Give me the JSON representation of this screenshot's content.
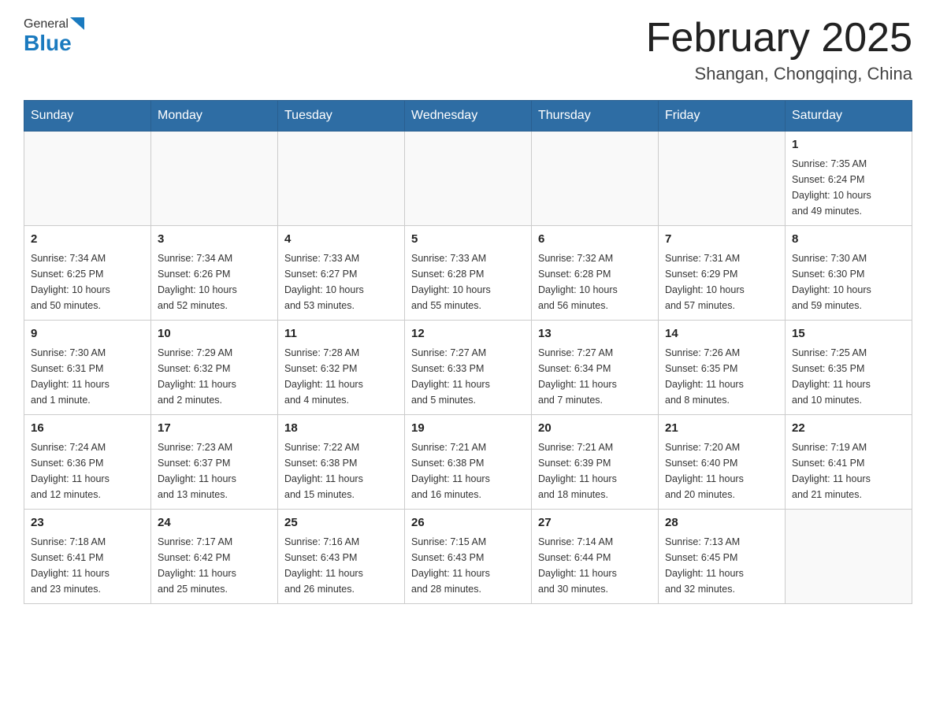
{
  "header": {
    "logo_general": "General",
    "logo_blue": "Blue",
    "month_title": "February 2025",
    "location": "Shangan, Chongqing, China"
  },
  "days_of_week": [
    "Sunday",
    "Monday",
    "Tuesday",
    "Wednesday",
    "Thursday",
    "Friday",
    "Saturday"
  ],
  "weeks": [
    {
      "cells": [
        {
          "day": "",
          "info": ""
        },
        {
          "day": "",
          "info": ""
        },
        {
          "day": "",
          "info": ""
        },
        {
          "day": "",
          "info": ""
        },
        {
          "day": "",
          "info": ""
        },
        {
          "day": "",
          "info": ""
        },
        {
          "day": "1",
          "info": "Sunrise: 7:35 AM\nSunset: 6:24 PM\nDaylight: 10 hours\nand 49 minutes."
        }
      ]
    },
    {
      "cells": [
        {
          "day": "2",
          "info": "Sunrise: 7:34 AM\nSunset: 6:25 PM\nDaylight: 10 hours\nand 50 minutes."
        },
        {
          "day": "3",
          "info": "Sunrise: 7:34 AM\nSunset: 6:26 PM\nDaylight: 10 hours\nand 52 minutes."
        },
        {
          "day": "4",
          "info": "Sunrise: 7:33 AM\nSunset: 6:27 PM\nDaylight: 10 hours\nand 53 minutes."
        },
        {
          "day": "5",
          "info": "Sunrise: 7:33 AM\nSunset: 6:28 PM\nDaylight: 10 hours\nand 55 minutes."
        },
        {
          "day": "6",
          "info": "Sunrise: 7:32 AM\nSunset: 6:28 PM\nDaylight: 10 hours\nand 56 minutes."
        },
        {
          "day": "7",
          "info": "Sunrise: 7:31 AM\nSunset: 6:29 PM\nDaylight: 10 hours\nand 57 minutes."
        },
        {
          "day": "8",
          "info": "Sunrise: 7:30 AM\nSunset: 6:30 PM\nDaylight: 10 hours\nand 59 minutes."
        }
      ]
    },
    {
      "cells": [
        {
          "day": "9",
          "info": "Sunrise: 7:30 AM\nSunset: 6:31 PM\nDaylight: 11 hours\nand 1 minute."
        },
        {
          "day": "10",
          "info": "Sunrise: 7:29 AM\nSunset: 6:32 PM\nDaylight: 11 hours\nand 2 minutes."
        },
        {
          "day": "11",
          "info": "Sunrise: 7:28 AM\nSunset: 6:32 PM\nDaylight: 11 hours\nand 4 minutes."
        },
        {
          "day": "12",
          "info": "Sunrise: 7:27 AM\nSunset: 6:33 PM\nDaylight: 11 hours\nand 5 minutes."
        },
        {
          "day": "13",
          "info": "Sunrise: 7:27 AM\nSunset: 6:34 PM\nDaylight: 11 hours\nand 7 minutes."
        },
        {
          "day": "14",
          "info": "Sunrise: 7:26 AM\nSunset: 6:35 PM\nDaylight: 11 hours\nand 8 minutes."
        },
        {
          "day": "15",
          "info": "Sunrise: 7:25 AM\nSunset: 6:35 PM\nDaylight: 11 hours\nand 10 minutes."
        }
      ]
    },
    {
      "cells": [
        {
          "day": "16",
          "info": "Sunrise: 7:24 AM\nSunset: 6:36 PM\nDaylight: 11 hours\nand 12 minutes."
        },
        {
          "day": "17",
          "info": "Sunrise: 7:23 AM\nSunset: 6:37 PM\nDaylight: 11 hours\nand 13 minutes."
        },
        {
          "day": "18",
          "info": "Sunrise: 7:22 AM\nSunset: 6:38 PM\nDaylight: 11 hours\nand 15 minutes."
        },
        {
          "day": "19",
          "info": "Sunrise: 7:21 AM\nSunset: 6:38 PM\nDaylight: 11 hours\nand 16 minutes."
        },
        {
          "day": "20",
          "info": "Sunrise: 7:21 AM\nSunset: 6:39 PM\nDaylight: 11 hours\nand 18 minutes."
        },
        {
          "day": "21",
          "info": "Sunrise: 7:20 AM\nSunset: 6:40 PM\nDaylight: 11 hours\nand 20 minutes."
        },
        {
          "day": "22",
          "info": "Sunrise: 7:19 AM\nSunset: 6:41 PM\nDaylight: 11 hours\nand 21 minutes."
        }
      ]
    },
    {
      "cells": [
        {
          "day": "23",
          "info": "Sunrise: 7:18 AM\nSunset: 6:41 PM\nDaylight: 11 hours\nand 23 minutes."
        },
        {
          "day": "24",
          "info": "Sunrise: 7:17 AM\nSunset: 6:42 PM\nDaylight: 11 hours\nand 25 minutes."
        },
        {
          "day": "25",
          "info": "Sunrise: 7:16 AM\nSunset: 6:43 PM\nDaylight: 11 hours\nand 26 minutes."
        },
        {
          "day": "26",
          "info": "Sunrise: 7:15 AM\nSunset: 6:43 PM\nDaylight: 11 hours\nand 28 minutes."
        },
        {
          "day": "27",
          "info": "Sunrise: 7:14 AM\nSunset: 6:44 PM\nDaylight: 11 hours\nand 30 minutes."
        },
        {
          "day": "28",
          "info": "Sunrise: 7:13 AM\nSunset: 6:45 PM\nDaylight: 11 hours\nand 32 minutes."
        },
        {
          "day": "",
          "info": ""
        }
      ]
    }
  ]
}
